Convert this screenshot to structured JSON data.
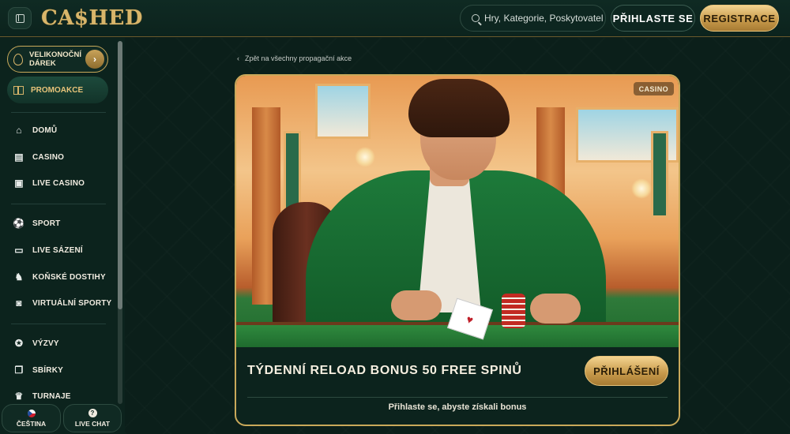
{
  "header": {
    "logo": "CA$HED",
    "search": {
      "placeholder": "Hry, Kategorie, Poskytovatelé"
    },
    "login_label": "PŘIHLASTE SE",
    "register_label": "REGISTRACE"
  },
  "sidebar": {
    "easter_promo": "VELIKONOČNÍ DÁREK",
    "promo": "PROMOAKCE",
    "items": [
      {
        "label": "DOMŮ",
        "icon": "home-icon",
        "glyph": "⌂"
      },
      {
        "label": "CASINO",
        "icon": "slot-machine-icon",
        "glyph": "▤"
      },
      {
        "label": "LIVE CASINO",
        "icon": "cards-icon",
        "glyph": "▣"
      },
      {
        "label": "SPORT",
        "icon": "soccer-ball-icon",
        "glyph": "⚽"
      },
      {
        "label": "LIVE SÁZENÍ",
        "icon": "live-icon",
        "glyph": "▭"
      },
      {
        "label": "KOŇSKÉ DOSTIHY",
        "icon": "horse-icon",
        "glyph": "♞"
      },
      {
        "label": "VIRTUÁLNÍ SPORTY",
        "icon": "virtual-sports-icon",
        "glyph": "◙"
      },
      {
        "label": "VÝZVY",
        "icon": "medal-icon",
        "glyph": "✪"
      },
      {
        "label": "SBÍRKY",
        "icon": "collection-icon",
        "glyph": "❐"
      },
      {
        "label": "TURNAJE",
        "icon": "trophy-icon",
        "glyph": "♛"
      }
    ],
    "language": "ČEŠTINA",
    "chat": "LIVE CHAT"
  },
  "main": {
    "back_link": "Zpět na všechny propagační akce",
    "card": {
      "badge": "CASINO",
      "title": "TÝDENNÍ RELOAD BONUS 50 FREE SPINŮ",
      "button": "PŘIHLÁŠENÍ",
      "subtitle": "Přihlaste se, abyste získali bonus"
    }
  }
}
